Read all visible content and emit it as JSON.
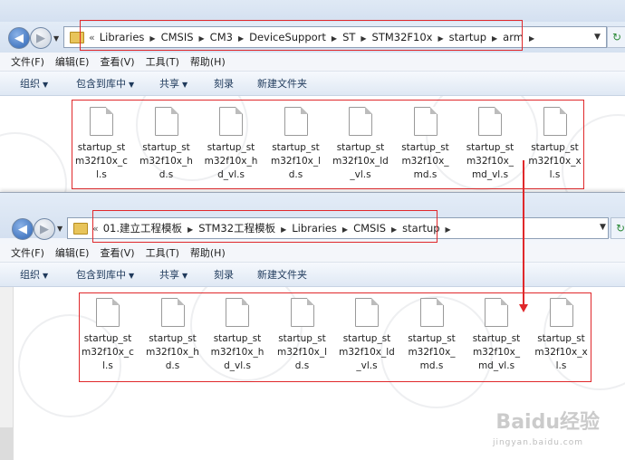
{
  "window1": {
    "breadcrumb": [
      "Libraries",
      "CMSIS",
      "CM3",
      "DeviceSupport",
      "ST",
      "STM32F10x",
      "startup",
      "arm"
    ],
    "menu": [
      "文件(F)",
      "编辑(E)",
      "查看(V)",
      "工具(T)",
      "帮助(H)"
    ],
    "commands": [
      "组织",
      "包含到库中",
      "共享",
      "刻录",
      "新建文件夹"
    ],
    "files": [
      "startup_stm32f10x_cl.s",
      "startup_stm32f10x_hd.s",
      "startup_stm32f10x_hd_vl.s",
      "startup_stm32f10x_ld.s",
      "startup_stm32f10x_ld_vl.s",
      "startup_stm32f10x_md.s",
      "startup_stm32f10x_md_vl.s",
      "startup_stm32f10x_xl.s"
    ]
  },
  "window2": {
    "breadcrumb": [
      "01.建立工程模板",
      "STM32工程模板",
      "Libraries",
      "CMSIS",
      "startup"
    ],
    "menu": [
      "文件(F)",
      "编辑(E)",
      "查看(V)",
      "工具(T)",
      "帮助(H)"
    ],
    "commands": [
      "组织",
      "包含到库中",
      "共享",
      "刻录",
      "新建文件夹"
    ],
    "files": [
      "startup_stm32f10x_cl.s",
      "startup_stm32f10x_hd.s",
      "startup_stm32f10x_hd_vl.s",
      "startup_stm32f10x_ld.s",
      "startup_stm32f10x_ld_vl.s",
      "startup_stm32f10x_md.s",
      "startup_stm32f10x_md_vl.s",
      "startup_stm32f10x_xl.s"
    ]
  },
  "chevron": "«",
  "watermark": {
    "logo": "Baidu经验",
    "url": "jingyan.baidu.com"
  },
  "colors": {
    "highlight": "#e0282b"
  }
}
